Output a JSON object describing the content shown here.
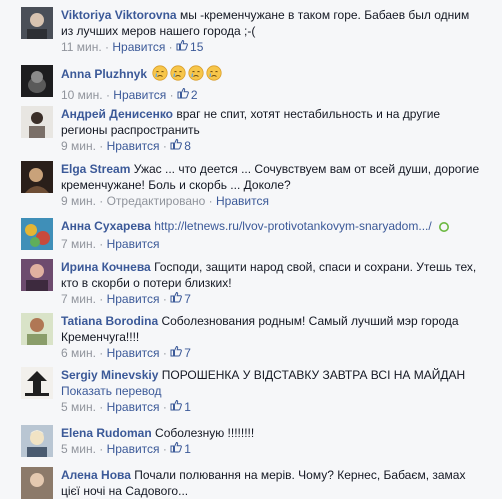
{
  "comments": [
    {
      "author": "Viktoriya Viktorovna",
      "text": "мы -кременчужане в таком горе. Бабаев был одним из лучших меров нашего города ;-(",
      "time": "11 мин.",
      "like_action": "Нравится",
      "likes": "15"
    },
    {
      "author": "Anna Pluzhnyk",
      "text": "",
      "emoji": [
        "crying-face",
        "crying-face",
        "crying-face",
        "crying-face"
      ],
      "time": "10 мин.",
      "like_action": "Нравится",
      "likes": "2"
    },
    {
      "author": "Андрей Денисенко",
      "text": "враг не спит, хотят нестабильность и на другие регионы распространить",
      "time": "9 мин.",
      "like_action": "Нравится",
      "likes": "8"
    },
    {
      "author": "Elga Stream",
      "text": "Ужас ... что деется ... Сочувствуем вам от всей души, дорогие кременчужане! Боль и скорбь ... Доколе?",
      "time": "9 мин.",
      "edited": "Отредактировано",
      "like_action": "Нравится"
    },
    {
      "author": "Анна Сухарева",
      "link": "http://letnews.ru/lvov-protivotankovym-snaryadom.../",
      "time": "7 мин.",
      "like_action": "Нравится"
    },
    {
      "author": "Ирина Кочнева",
      "text": "Господи, защити народ свой, спаси и сохрани. Утешь тех, кто в скорби о потери близких!",
      "time": "7 мин.",
      "like_action": "Нравится",
      "likes": "7"
    },
    {
      "author": "Tatiana Borodina",
      "text": "Соболезнования родным! Самый лучший мэр города Кременчуга!!!!",
      "time": "6 мин.",
      "like_action": "Нравится",
      "likes": "7"
    },
    {
      "author": "Sergiy Minevskiy",
      "text": "ПОРОШЕНКА У ВІДСТАВКУ ЗАВТРА ВСІ НА МАЙДАН",
      "translate": "Показать перевод",
      "time": "5 мин.",
      "like_action": "Нравится",
      "likes": "1"
    },
    {
      "author": "Elena Rudoman",
      "text": "Соболезную !!!!!!!!",
      "time": "5 мин.",
      "like_action": "Нравится",
      "likes": "1"
    },
    {
      "author": "Алена Нова",
      "text": "Почали полювання на мерів. Чому? Кернес, Бабаєм, замах цієї ночі на Садового..."
    }
  ],
  "colors": {
    "link": "#3b5998",
    "text": "#141823",
    "meta": "#90949c",
    "background": "#f6f7f9"
  }
}
